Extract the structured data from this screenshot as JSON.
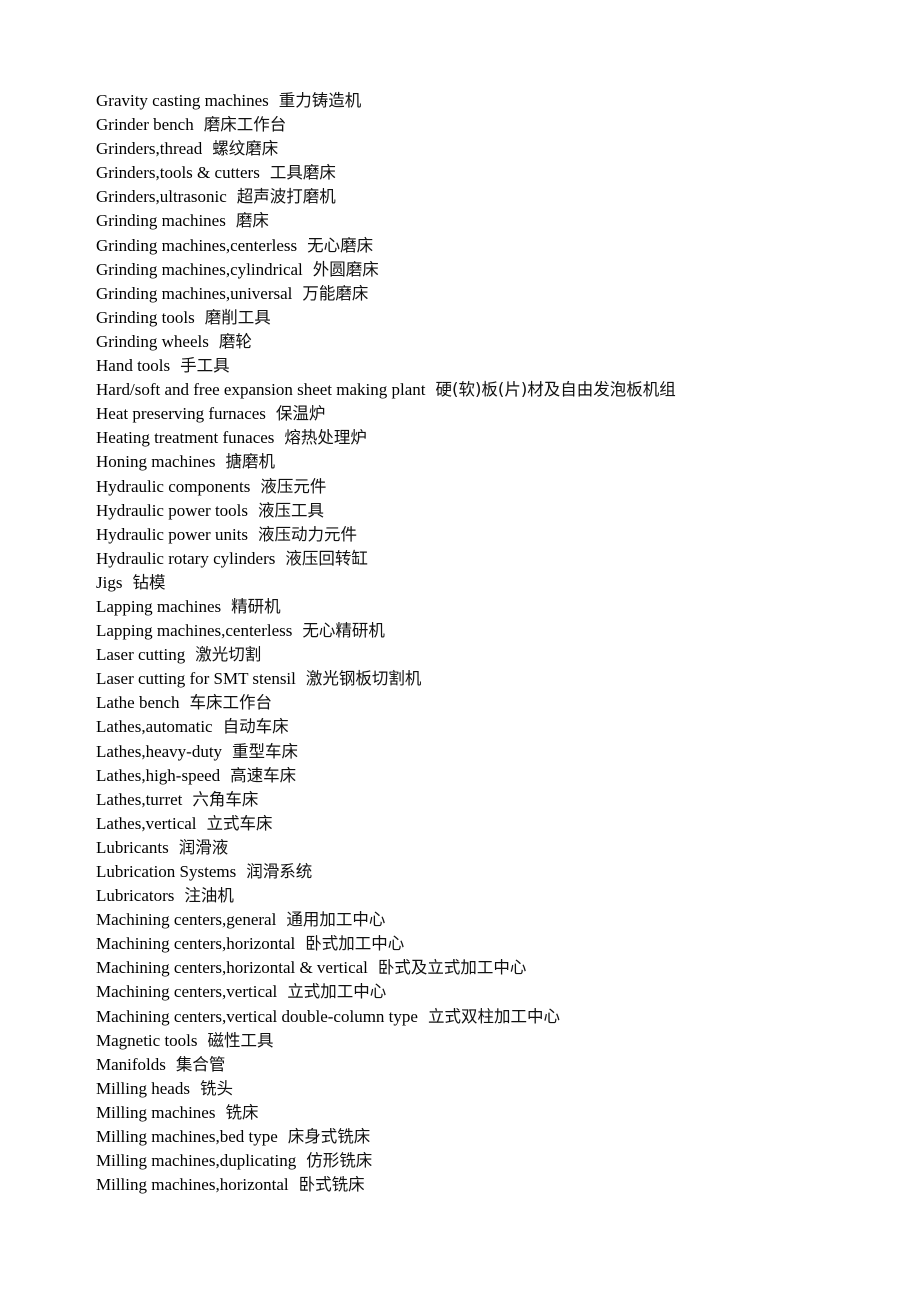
{
  "document": {
    "entries": [
      {
        "en": "Gravity casting machines",
        "zh": "重力铸造机"
      },
      {
        "en": "Grinder bench",
        "zh": "磨床工作台"
      },
      {
        "en": "Grinders,thread",
        "zh": "螺纹磨床"
      },
      {
        "en": "Grinders,tools & cutters",
        "zh": "工具磨床"
      },
      {
        "en": "Grinders,ultrasonic",
        "zh": "超声波打磨机"
      },
      {
        "en": "Grinding machines",
        "zh": "磨床"
      },
      {
        "en": "Grinding machines,centerless",
        "zh": "无心磨床"
      },
      {
        "en": "Grinding machines,cylindrical",
        "zh": "外圆磨床"
      },
      {
        "en": "Grinding machines,universal",
        "zh": "万能磨床"
      },
      {
        "en": "Grinding tools",
        "zh": "磨削工具"
      },
      {
        "en": "Grinding wheels",
        "zh": "磨轮"
      },
      {
        "en": "Hand tools",
        "zh": "手工具"
      },
      {
        "en": "Hard/soft and free expansion sheet making plant",
        "zh": "硬(软)板(片)材及自由发泡板机组"
      },
      {
        "en": "Heat preserving furnaces",
        "zh": "保温炉"
      },
      {
        "en": "Heating treatment funaces",
        "zh": "熔热处理炉"
      },
      {
        "en": "Honing machines",
        "zh": "搪磨机"
      },
      {
        "en": "Hydraulic components",
        "zh": "液压元件"
      },
      {
        "en": "Hydraulic power tools",
        "zh": "液压工具"
      },
      {
        "en": "Hydraulic power units",
        "zh": "液压动力元件"
      },
      {
        "en": "Hydraulic rotary cylinders",
        "zh": "液压回转缸"
      },
      {
        "en": "Jigs",
        "zh": "钻模"
      },
      {
        "en": "Lapping machines",
        "zh": "精研机"
      },
      {
        "en": "Lapping machines,centerless",
        "zh": "无心精研机"
      },
      {
        "en": "Laser cutting",
        "zh": "激光切割"
      },
      {
        "en": "Laser cutting for SMT stensil",
        "zh": "激光钢板切割机"
      },
      {
        "en": "Lathe bench",
        "zh": "车床工作台"
      },
      {
        "en": "Lathes,automatic",
        "zh": "自动车床"
      },
      {
        "en": "Lathes,heavy-duty",
        "zh": "重型车床"
      },
      {
        "en": "Lathes,high-speed",
        "zh": "高速车床"
      },
      {
        "en": "Lathes,turret",
        "zh": "六角车床"
      },
      {
        "en": "Lathes,vertical",
        "zh": "立式车床"
      },
      {
        "en": "Lubricants",
        "zh": "润滑液"
      },
      {
        "en": "Lubrication Systems",
        "zh": "润滑系统"
      },
      {
        "en": "Lubricators",
        "zh": "注油机"
      },
      {
        "en": "Machining centers,general",
        "zh": "通用加工中心"
      },
      {
        "en": "Machining centers,horizontal",
        "zh": "卧式加工中心"
      },
      {
        "en": "Machining centers,horizontal & vertical",
        "zh": "卧式及立式加工中心"
      },
      {
        "en": "Machining centers,vertical",
        "zh": "立式加工中心"
      },
      {
        "en": "Machining centers,vertical double-column type",
        "zh": "立式双柱加工中心"
      },
      {
        "en": "Magnetic tools",
        "zh": "磁性工具"
      },
      {
        "en": "Manifolds",
        "zh": "集合管"
      },
      {
        "en": "Milling heads",
        "zh": "铣头"
      },
      {
        "en": "Milling machines",
        "zh": "铣床"
      },
      {
        "en": "Milling machines,bed type",
        "zh": "床身式铣床"
      },
      {
        "en": "Milling machines,duplicating",
        "zh": "仿形铣床"
      },
      {
        "en": "Milling machines,horizontal",
        "zh": "卧式铣床"
      }
    ]
  }
}
